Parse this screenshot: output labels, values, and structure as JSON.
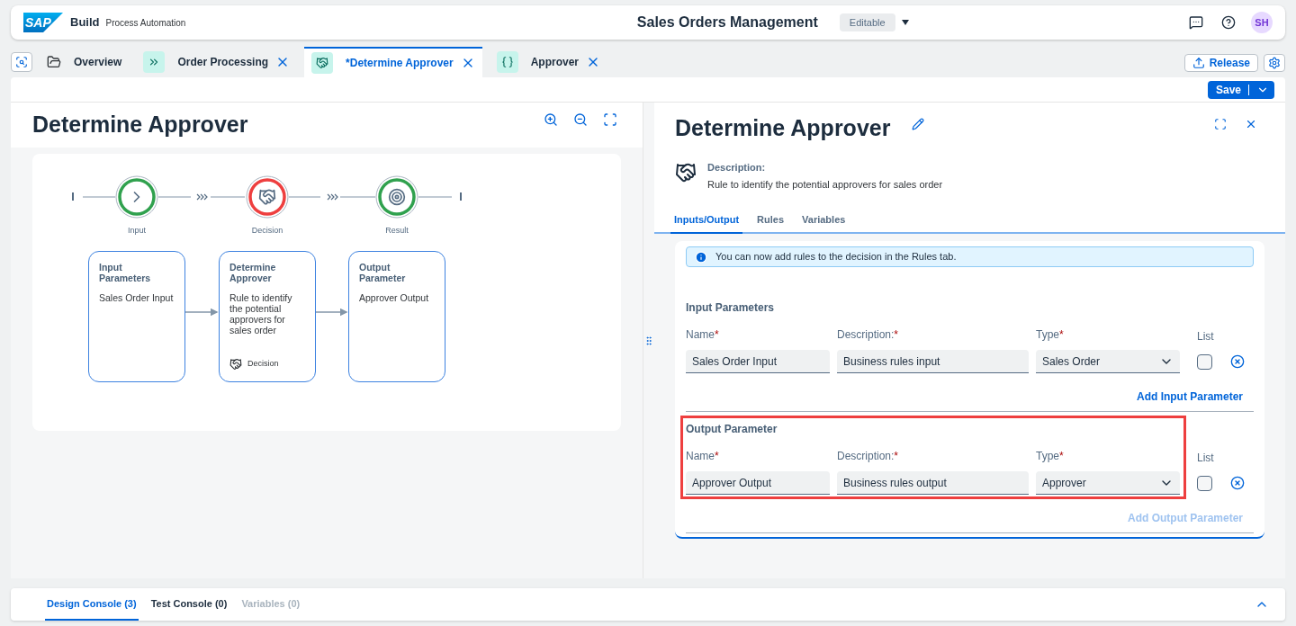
{
  "header": {
    "logo": "SAP",
    "product": "Build",
    "subtitle": "Process Automation",
    "title": "Sales Orders Management",
    "status": "Editable",
    "avatar": "SH"
  },
  "tabs": [
    {
      "kind": "overview",
      "label": "Overview",
      "selected": false,
      "closable": false
    },
    {
      "kind": "process",
      "label": "Order Processing",
      "selected": false,
      "closable": true
    },
    {
      "kind": "decision",
      "label": "*Determine Approver",
      "selected": true,
      "closable": true
    },
    {
      "kind": "data",
      "label": "Approver",
      "selected": false,
      "closable": true
    }
  ],
  "toolbar": {
    "release": "Release",
    "save": "Save"
  },
  "canvas": {
    "title": "Determine Approver",
    "steps": [
      {
        "kind": "input",
        "label": "Input",
        "color": "#30a14e"
      },
      {
        "kind": "decision",
        "label": "Decision",
        "color": "#ee3f3f"
      },
      {
        "kind": "result",
        "label": "Result",
        "color": "#30a14e"
      }
    ],
    "cards": [
      {
        "title": "Input Parameters",
        "text": "Sales Order Input"
      },
      {
        "title": "Determine Approver",
        "text": "Rule to identify the potential approvers for sales order",
        "badge": "Decision"
      },
      {
        "title": "Output Parameter",
        "text": "Approver Output"
      }
    ]
  },
  "details": {
    "title": "Determine Approver",
    "description_label": "Description:",
    "description": "Rule to identify the potential approvers for sales order",
    "tabs": [
      {
        "label": "Inputs/Output",
        "selected": true
      },
      {
        "label": "Rules",
        "selected": false
      },
      {
        "label": "Variables",
        "selected": false
      }
    ],
    "info": "You can now add rules to the decision in the Rules tab.",
    "sections": [
      {
        "title": "Input Parameters",
        "highlighted": false,
        "labels": [
          {
            "text": "Name",
            "mark": "*"
          },
          {
            "text": "Description:",
            "mark": "*"
          },
          {
            "text": "Type",
            "mark": "*"
          }
        ],
        "list_label": "List",
        "row": {
          "name": "Sales Order Input",
          "description": "Business rules input",
          "type": "Sales Order",
          "list": false
        },
        "add": "Add Input Parameter",
        "add_disabled": false
      },
      {
        "title": "Output Parameter",
        "highlighted": true,
        "labels": [
          {
            "text": "Name",
            "mark": "*"
          },
          {
            "text": "Description:",
            "mark": "*"
          },
          {
            "text": "Type",
            "mark": "*"
          }
        ],
        "list_label": "List",
        "row": {
          "name": "Approver Output",
          "description": "Business rules output",
          "type": "Approver",
          "list": false
        },
        "add": "Add Output Parameter",
        "add_disabled": true
      }
    ]
  },
  "console": {
    "tabs": [
      {
        "label": "Design Console (3)",
        "selected": true,
        "disabled": false
      },
      {
        "label": "Test Console (0)",
        "selected": false,
        "disabled": false
      },
      {
        "label": "Variables (0)",
        "selected": false,
        "disabled": true
      }
    ]
  }
}
